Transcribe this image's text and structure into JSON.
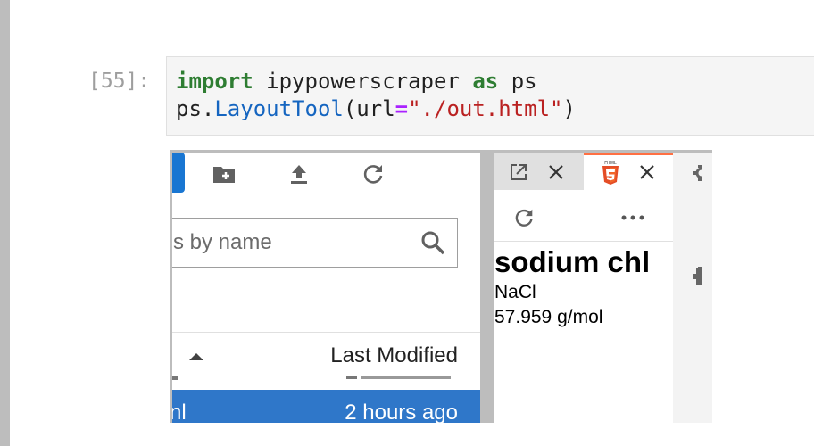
{
  "cell": {
    "prompt": "[55]:",
    "code": {
      "line1": {
        "kw1": "import",
        "mod": " ipypowerscraper ",
        "kw2": "as",
        "alias": " ps"
      },
      "line2": {
        "obj": "ps.",
        "cls": "LayoutTool",
        "open": "(url",
        "eq": "=",
        "str": "\"./out.html\"",
        "close": ")"
      }
    }
  },
  "output": {
    "file_browser": {
      "toolbar": [
        "new-folder-icon",
        "upload-icon",
        "refresh-icon"
      ],
      "search_placeholder": "s by name",
      "header": {
        "modified_label": "Last Modified",
        "sort_icon": "caret-up-icon"
      },
      "selected_row": {
        "name": "nl",
        "modified": "2 hours ago"
      }
    },
    "viewer": {
      "tabs": [
        {
          "icons": [
            "open-external-icon",
            "close-icon"
          ]
        },
        {
          "icons": [
            "html5-icon",
            "close-icon"
          ],
          "active": true
        }
      ],
      "toolbar": [
        "refresh-icon",
        "more-icon"
      ],
      "doc": {
        "title": "sodium chl",
        "formula": "NaCl",
        "mass": "57.959 g/mol"
      }
    },
    "colors": {
      "accent": "#1976d2",
      "selected": "#2f77c9",
      "html5": "#e44d26",
      "tab_active": "#ff7043"
    }
  }
}
